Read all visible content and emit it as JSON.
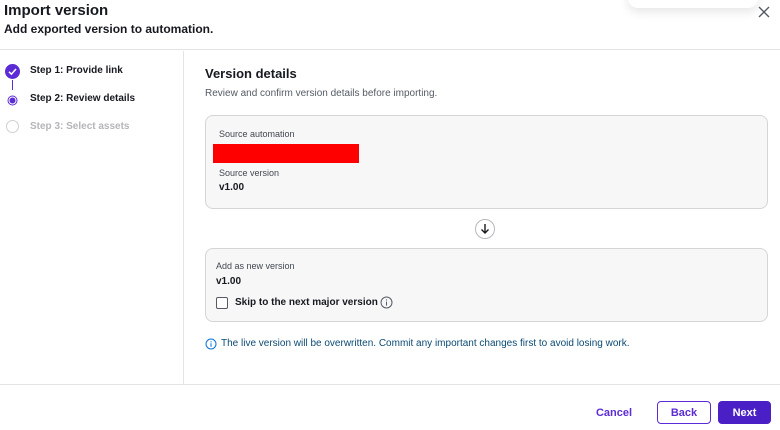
{
  "dialog": {
    "title": "Import version",
    "subtitle": "Add exported version to automation."
  },
  "steps": [
    {
      "label": "Step 1: Provide link",
      "state": "completed"
    },
    {
      "label": "Step 2: Review details",
      "state": "current"
    },
    {
      "label": "Step 3: Select assets",
      "state": "disabled"
    }
  ],
  "content": {
    "section_title": "Version details",
    "section_description": "Review and confirm version details before importing.",
    "source_card": {
      "automation_label": "Source automation",
      "version_label": "Source version",
      "version_value": "v1.00"
    },
    "target_card": {
      "new_version_label": "Add as new version",
      "new_version_value": "v1.00",
      "skip_major_label": "Skip to the next major version",
      "skip_major_checked": false
    },
    "notice": "The live version will be overwritten. Commit any important changes first to avoid losing work."
  },
  "footer": {
    "cancel_label": "Cancel",
    "back_label": "Back",
    "next_label": "Next"
  },
  "colors": {
    "accent": "#5b2bd6",
    "primary_button": "#4a1fc6",
    "info_text": "#0a4a74",
    "redaction": "#ff0000"
  }
}
